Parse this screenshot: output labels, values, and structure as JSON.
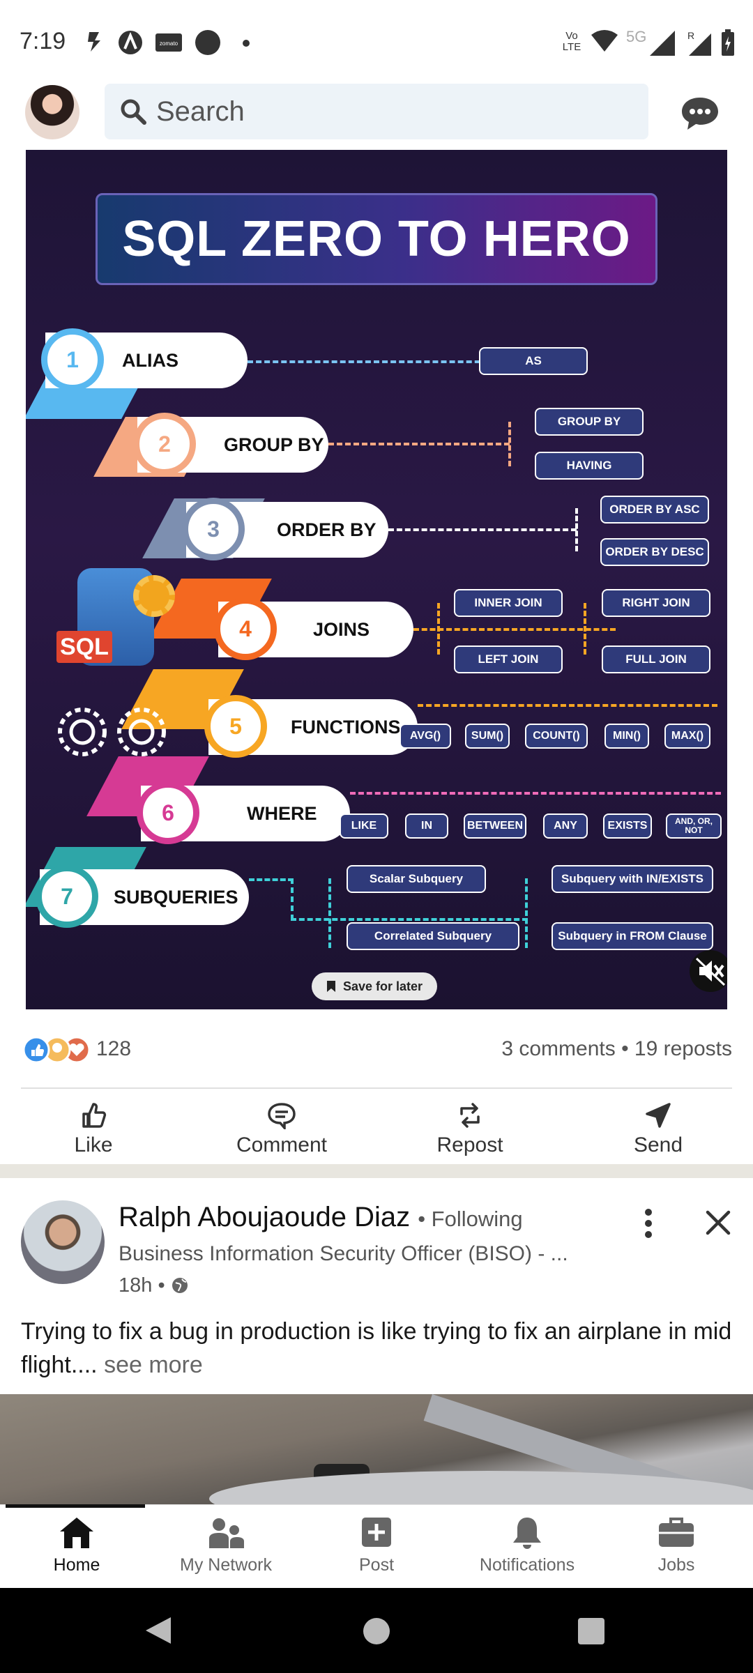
{
  "status_bar": {
    "time": "7:19",
    "network": "5G",
    "lte": "Vo LTE"
  },
  "top_bar": {
    "search_placeholder": "Search"
  },
  "infographic": {
    "title": "SQL ZERO TO HERO",
    "logo_text": "SQL",
    "steps": [
      {
        "num": "1",
        "label": "ALIAS",
        "chips": [
          "AS"
        ]
      },
      {
        "num": "2",
        "label": "GROUP BY",
        "chips": [
          "GROUP BY",
          "HAVING"
        ]
      },
      {
        "num": "3",
        "label": "ORDER BY",
        "chips": [
          "ORDER BY ASC",
          "ORDER BY DESC"
        ]
      },
      {
        "num": "4",
        "label": "JOINS",
        "chips": [
          "INNER JOIN",
          "LEFT JOIN",
          "RIGHT JOIN",
          "FULL JOIN"
        ]
      },
      {
        "num": "5",
        "label": "FUNCTIONS",
        "chips": [
          "AVG()",
          "SUM()",
          "COUNT()",
          "MIN()",
          "MAX()"
        ]
      },
      {
        "num": "6",
        "label": "WHERE",
        "chips": [
          "LIKE",
          "IN",
          "BETWEEN",
          "ANY",
          "EXISTS",
          "AND, OR, NOT"
        ]
      },
      {
        "num": "7",
        "label": "SUBQUERIES",
        "chips": [
          "Scalar Subquery",
          "Correlated Subquery",
          "Subquery with IN/EXISTS",
          "Subquery in FROM Clause"
        ]
      }
    ],
    "save_label": "Save for later"
  },
  "social": {
    "reaction_count": "128",
    "stats": "3 comments • 19 reposts"
  },
  "actions": {
    "like": "Like",
    "comment": "Comment",
    "repost": "Repost",
    "send": "Send"
  },
  "post2": {
    "author": "Ralph Aboujaoude Diaz",
    "following": "• Following",
    "headline": "Business Information Security Officer (BISO) - ...",
    "time": "18h •",
    "text": "Trying to fix a bug in production is like trying to fix an airplane in mid flight....",
    "see_more": "see more"
  },
  "nav": {
    "home": "Home",
    "network": "My Network",
    "post": "Post",
    "notifications": "Notifications",
    "jobs": "Jobs"
  },
  "colors": {
    "accent_blue": "#0a66c2",
    "info_bg": "#221640"
  }
}
